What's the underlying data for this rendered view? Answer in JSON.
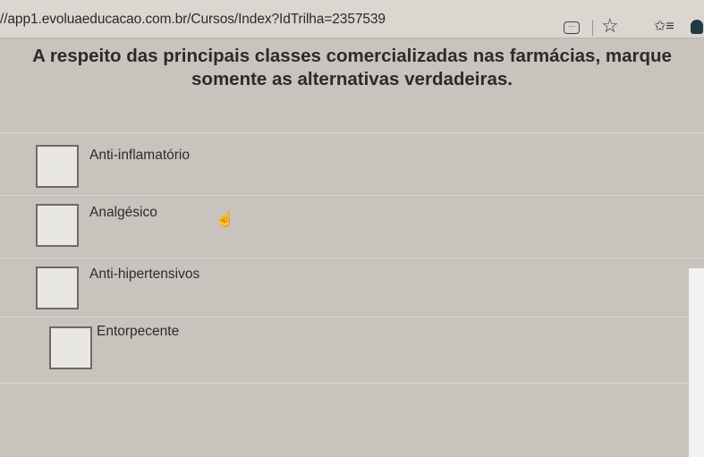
{
  "browser": {
    "url": "//app1.evoluaeducacao.com.br/Cursos/Index?IdTrilha=2357539",
    "icons": [
      "reader-icon",
      "star-icon",
      "favorites-icon",
      "profile-icon"
    ]
  },
  "question": {
    "text": "A respeito das principais classes comercializadas nas farmácias, marque somente as alternativas verdadeiras."
  },
  "options": [
    {
      "label": "Anti-inflamatório",
      "checked": false
    },
    {
      "label": "Analgésico",
      "checked": false
    },
    {
      "label": "Anti-hipertensivos",
      "checked": false
    },
    {
      "label": "Entorpecente",
      "checked": false
    }
  ],
  "colors": {
    "background": "#c9c3bd",
    "text": "#2b2b2b",
    "checkbox_border": "#6f6a66"
  }
}
